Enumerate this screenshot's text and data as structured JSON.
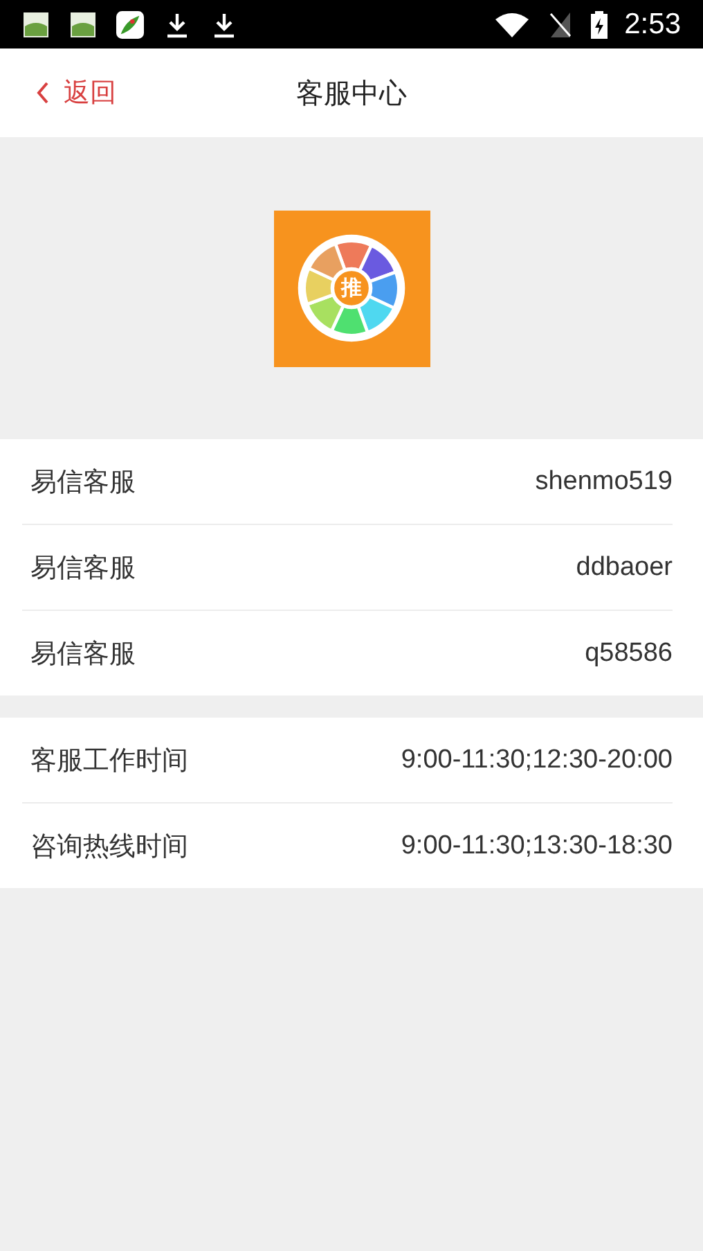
{
  "status_bar": {
    "time": "2:53"
  },
  "nav": {
    "back": "返回",
    "title": "客服中心"
  },
  "logo": {
    "text": "推"
  },
  "groups": [
    {
      "rows": [
        {
          "label": "易信客服",
          "value": "shenmo519"
        },
        {
          "label": "易信客服",
          "value": "ddbaoer"
        },
        {
          "label": "易信客服",
          "value": "q58586"
        }
      ]
    },
    {
      "rows": [
        {
          "label": "客服工作时间",
          "value": "9:00-11:30;12:30-20:00"
        },
        {
          "label": "咨询热线时间",
          "value": "9:00-11:30;13:30-18:30"
        }
      ]
    }
  ]
}
